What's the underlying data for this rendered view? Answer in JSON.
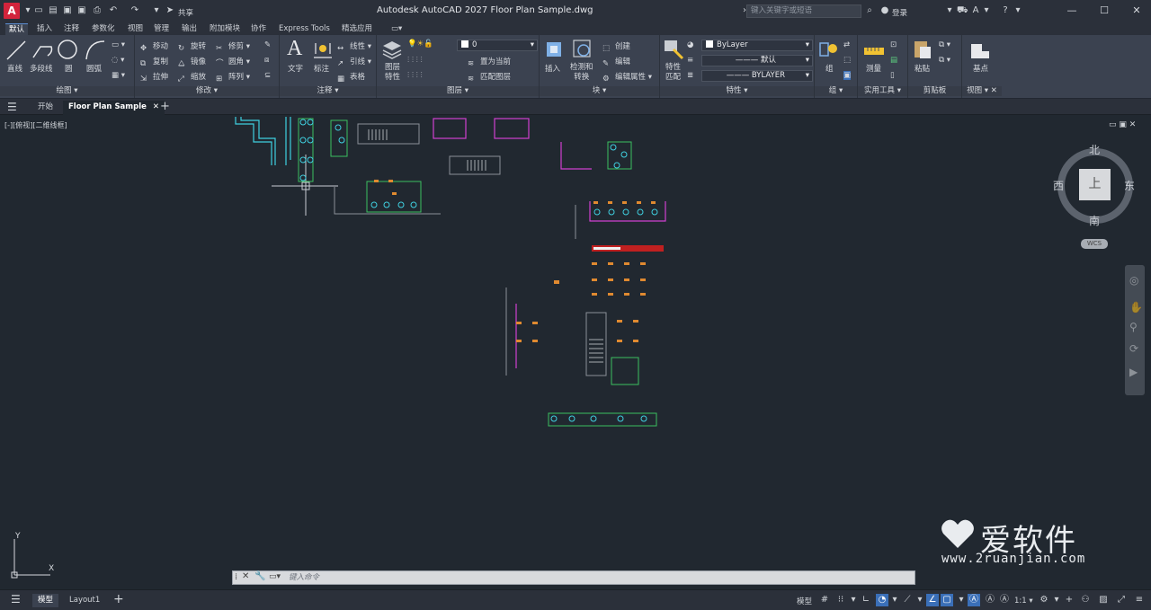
{
  "titlebar": {
    "app_letter": "A",
    "share_label": "共享",
    "title": "Autodesk AutoCAD 2027   Floor Plan Sample.dwg",
    "search_placeholder": "键入关键字或短语",
    "login_label": "登录"
  },
  "ribbon_tabs": [
    "默认",
    "插入",
    "注释",
    "参数化",
    "视图",
    "管理",
    "输出",
    "附加模块",
    "协作",
    "Express Tools",
    "精选应用"
  ],
  "ribbon": {
    "draw": {
      "label": "绘图",
      "line": "直线",
      "polyline": "多段线",
      "circle": "圆",
      "arc": "圆弧"
    },
    "modify": {
      "label": "修改",
      "move": "移动",
      "rotate": "旋转",
      "trim": "修剪",
      "copy": "复制",
      "mirror": "镜像",
      "fillet": "圆角",
      "stretch": "拉伸",
      "scale": "缩放",
      "array": "阵列"
    },
    "annotation": {
      "label": "注释",
      "text": "文字",
      "dimension": "标注",
      "linear": "线性",
      "leader": "引线",
      "table": "表格"
    },
    "layers": {
      "label": "图层",
      "layer_props": "图层\n特性",
      "current_layer": "0",
      "make_current": "置为当前",
      "match_layer": "匹配图层"
    },
    "block": {
      "label": "块",
      "insert": "插入",
      "edit_ref": "检测和\n转换",
      "create": "创建",
      "edit": "编辑",
      "edit_attrs": "编辑属性"
    },
    "properties": {
      "label": "特性",
      "match": "特性\n匹配",
      "color": "ByLayer",
      "lineweight": "默认",
      "linetype": "BYLAYER"
    },
    "groups": {
      "label": "组",
      "group": "组"
    },
    "utilities": {
      "label": "实用工具",
      "measure": "测量"
    },
    "clipboard": {
      "label": "剪贴板",
      "paste": "粘贴"
    },
    "view": {
      "label": "视图",
      "base": "基点"
    }
  },
  "doc_tabs": {
    "start": "开始",
    "active": "Floor Plan Sample"
  },
  "viewport_label": "[-][俯视][二维线框]",
  "viewcube": {
    "face": "上",
    "north": "北",
    "south": "南",
    "east": "东",
    "west": "西",
    "wcs": "WCS"
  },
  "ucs": {
    "x": "X",
    "y": "Y"
  },
  "command_placeholder": "键入命令",
  "status": {
    "model_tab": "模型",
    "layout_tab": "Layout1",
    "model_label": "模型",
    "scale": "1:1"
  },
  "watermark": {
    "brand": "爱软件",
    "url": "www.2ruanjian.com"
  }
}
